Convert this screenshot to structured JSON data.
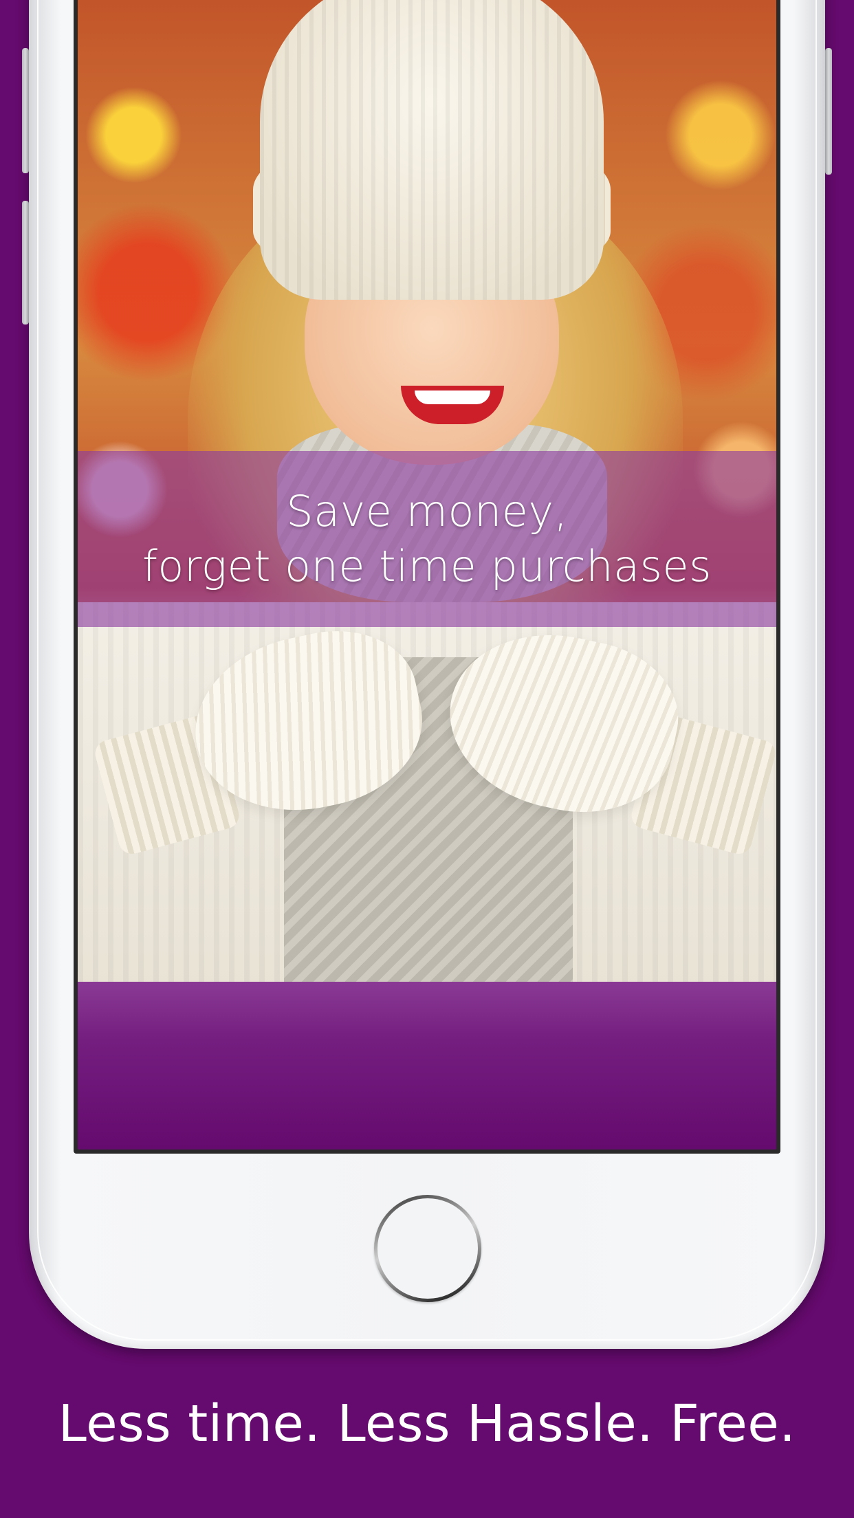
{
  "screen": {
    "banner": {
      "line1": "Save money,",
      "line2": "forget one time purchases"
    }
  },
  "tagline": "Less time. Less Hassle. Free.",
  "colors": {
    "background": "#650a6e",
    "banner_overlay": "#8c3ca0",
    "phone_body": "#f3f4f6"
  },
  "icons": {
    "home_button": "home-button-circle"
  }
}
